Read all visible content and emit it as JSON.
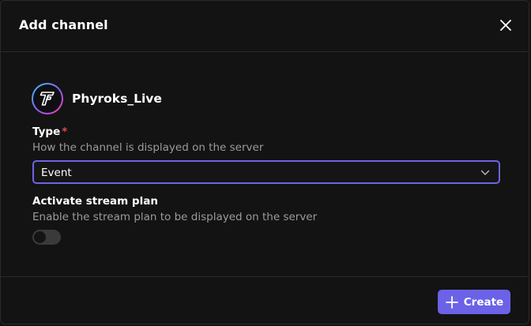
{
  "dialog": {
    "title": "Add channel",
    "close_icon": "close-icon"
  },
  "channel": {
    "name": "Phyroks_Live",
    "avatar_icon": "channel-logo-icon"
  },
  "type_field": {
    "label": "Type",
    "required_marker": "*",
    "help": "How the channel is displayed on the server",
    "selected_value": "Event"
  },
  "stream_plan": {
    "label": "Activate stream plan",
    "help": "Enable the stream plan to be displayed on the server",
    "enabled": false
  },
  "footer": {
    "create_label": "Create",
    "create_icon": "plus-icon"
  },
  "colors": {
    "accent": "#6b62e8",
    "focus_border": "#6e63e6",
    "required": "#e5484d",
    "background": "#131313"
  }
}
